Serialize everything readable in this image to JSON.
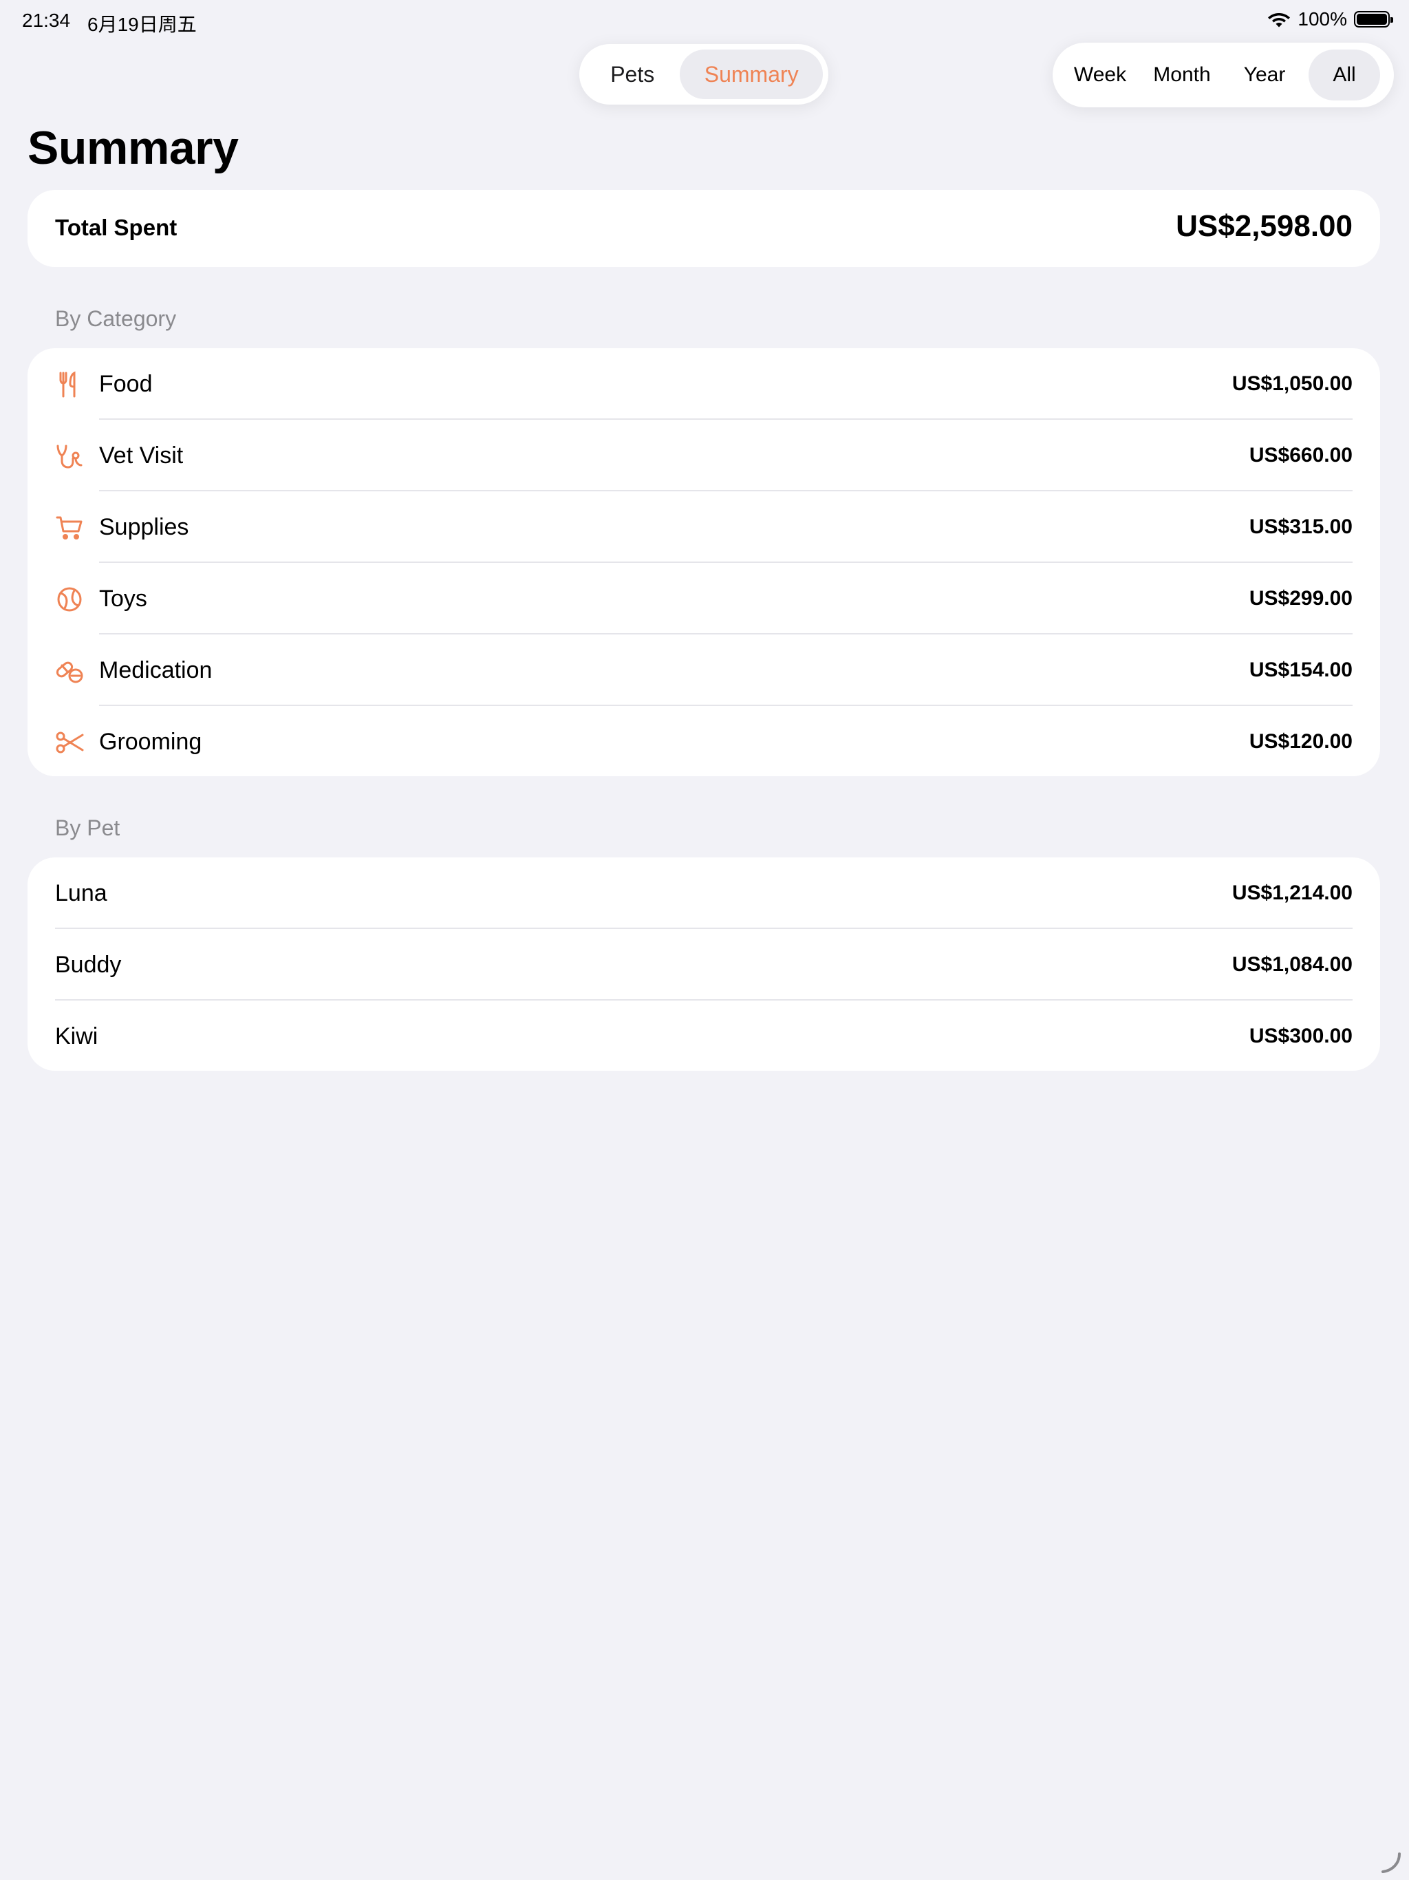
{
  "status_bar": {
    "time": "21:34",
    "date": "6月19日周五",
    "battery": "100%"
  },
  "main_tabs": [
    {
      "label": "Pets",
      "selected": false
    },
    {
      "label": "Summary",
      "selected": true
    }
  ],
  "range_options": [
    {
      "label": "Week",
      "selected": false
    },
    {
      "label": "Month",
      "selected": false
    },
    {
      "label": "Year",
      "selected": false
    },
    {
      "label": "All",
      "selected": true
    }
  ],
  "page_title": "Summary",
  "total": {
    "label": "Total Spent",
    "value": "US$2,598.00"
  },
  "by_category": {
    "header": "By Category",
    "rows": [
      {
        "icon": "fork-knife-icon",
        "label": "Food",
        "amount": "US$1,050.00"
      },
      {
        "icon": "stethoscope-icon",
        "label": "Vet Visit",
        "amount": "US$660.00"
      },
      {
        "icon": "cart-icon",
        "label": "Supplies",
        "amount": "US$315.00"
      },
      {
        "icon": "ball-icon",
        "label": "Toys",
        "amount": "US$299.00"
      },
      {
        "icon": "pills-icon",
        "label": "Medication",
        "amount": "US$154.00"
      },
      {
        "icon": "scissors-icon",
        "label": "Grooming",
        "amount": "US$120.00"
      }
    ]
  },
  "by_pet": {
    "header": "By Pet",
    "rows": [
      {
        "label": "Luna",
        "amount": "US$1,214.00"
      },
      {
        "label": "Buddy",
        "amount": "US$1,084.00"
      },
      {
        "label": "Kiwi",
        "amount": "US$300.00"
      }
    ]
  },
  "colors": {
    "accent": "#ef8354",
    "background": "#f2f2f7",
    "card": "#ffffff",
    "secondary_text": "#8a8a8e",
    "separator": "#e5e5ea"
  }
}
